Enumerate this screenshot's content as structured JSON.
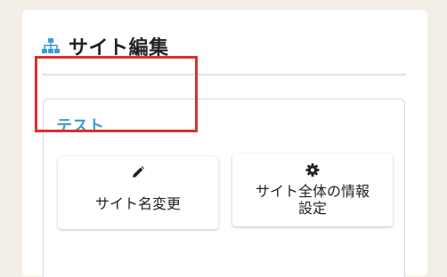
{
  "panel": {
    "title": "サイト編集",
    "header_icon": "sitemap-icon"
  },
  "card": {
    "title": "テスト",
    "buttons": [
      {
        "label": "サイト名変更",
        "icon": "pencil-icon"
      },
      {
        "label": "サイト全体の情報設定",
        "icon": "gear-icon"
      }
    ]
  },
  "colors": {
    "background": "#f3efe7",
    "accent": "#3d9bd6",
    "highlight": "#d9312b"
  }
}
